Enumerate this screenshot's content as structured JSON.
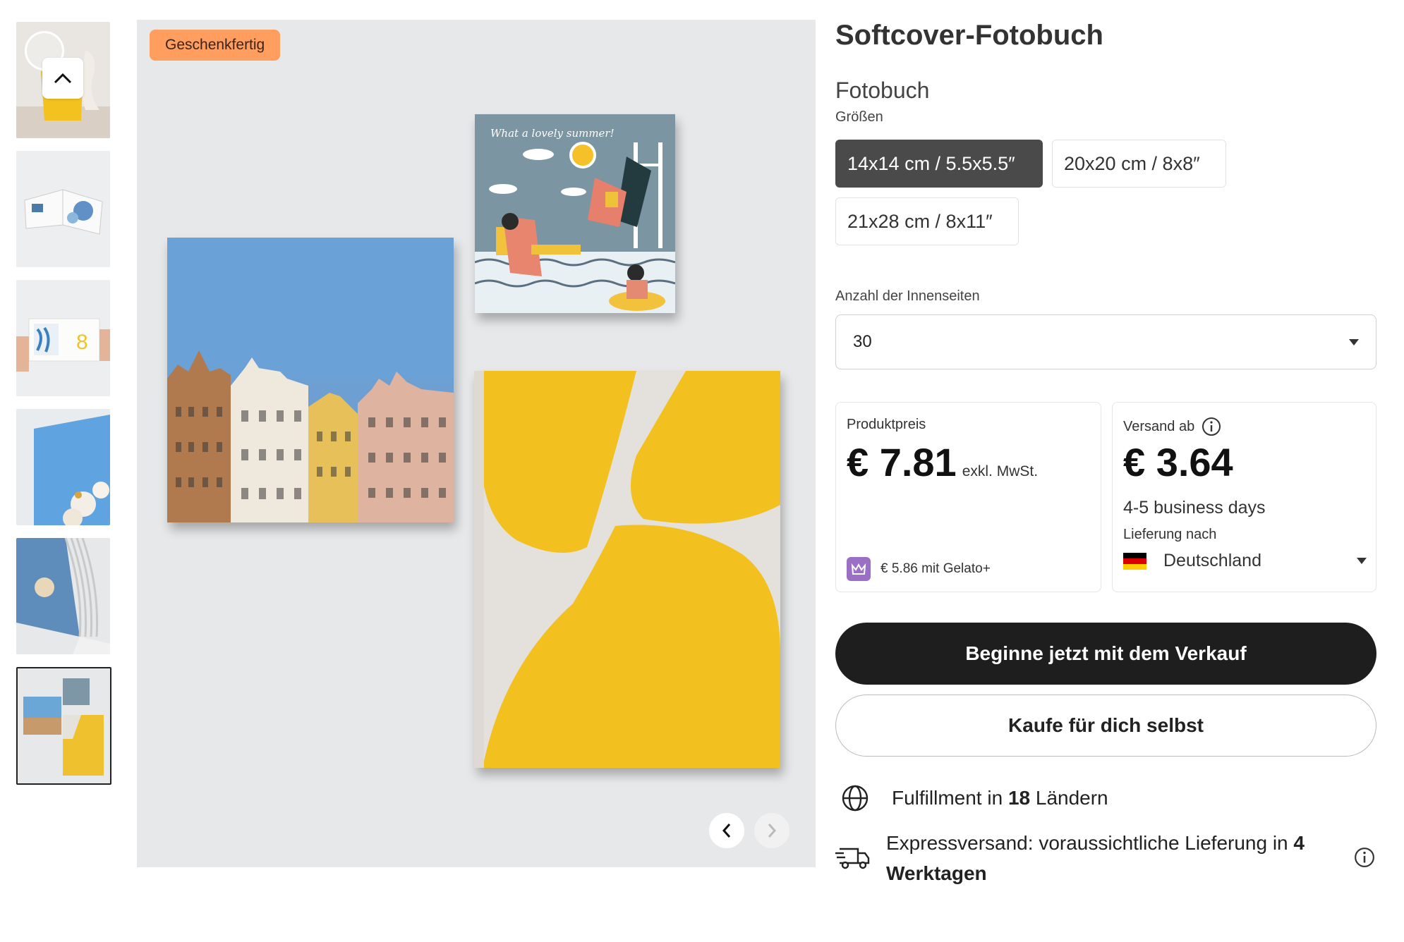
{
  "gallery": {
    "badge": "Geschenkfertig",
    "thumbnails": [
      "thumb-yellow-book",
      "thumb-open-book",
      "thumb-held-book",
      "thumb-flower-book",
      "thumb-pages-book",
      "thumb-three-books"
    ],
    "active_thumbnail": 5,
    "summer_book_text": "What a lovely summer!"
  },
  "product": {
    "title": "Softcover-Fotobuch",
    "subtitle": "Fotobuch",
    "sizes_label": "Größen",
    "sizes": [
      "14x14 cm / 5.5x5.5″",
      "20x20 cm / 8x8″",
      "21x28 cm / 8x11″"
    ],
    "selected_size": 0,
    "pages_label": "Anzahl der Innenseiten",
    "pages_value": "30"
  },
  "pricing": {
    "product_label": "Produktpreis",
    "product_price": "€ 7.81",
    "product_tax": "exkl. MwSt.",
    "gelato_plus": "€ 5.86 mit Gelato+",
    "shipping_label": "Versand ab",
    "shipping_price": "€ 3.64",
    "delivery_time": "4-5 business days",
    "delivery_to_label": "Lieferung nach",
    "country": "Deutschland"
  },
  "actions": {
    "primary": "Beginne jetzt mit dem Verkauf",
    "secondary": "Kaufe für dich selbst"
  },
  "features": {
    "fulfillment_prefix": "Fulfillment in ",
    "fulfillment_count": "18",
    "fulfillment_suffix": " Ländern",
    "express_prefix": "Expressversand: voraussichtliche Lieferung in ",
    "express_bold": "4 Werktagen"
  },
  "colors": {
    "selected_size_bg": "#4a4a4a",
    "badge_bg": "#ff9e5e",
    "primary_button_bg": "#1e1e1e",
    "gelato_icon_bg": "#9b6fc6"
  }
}
